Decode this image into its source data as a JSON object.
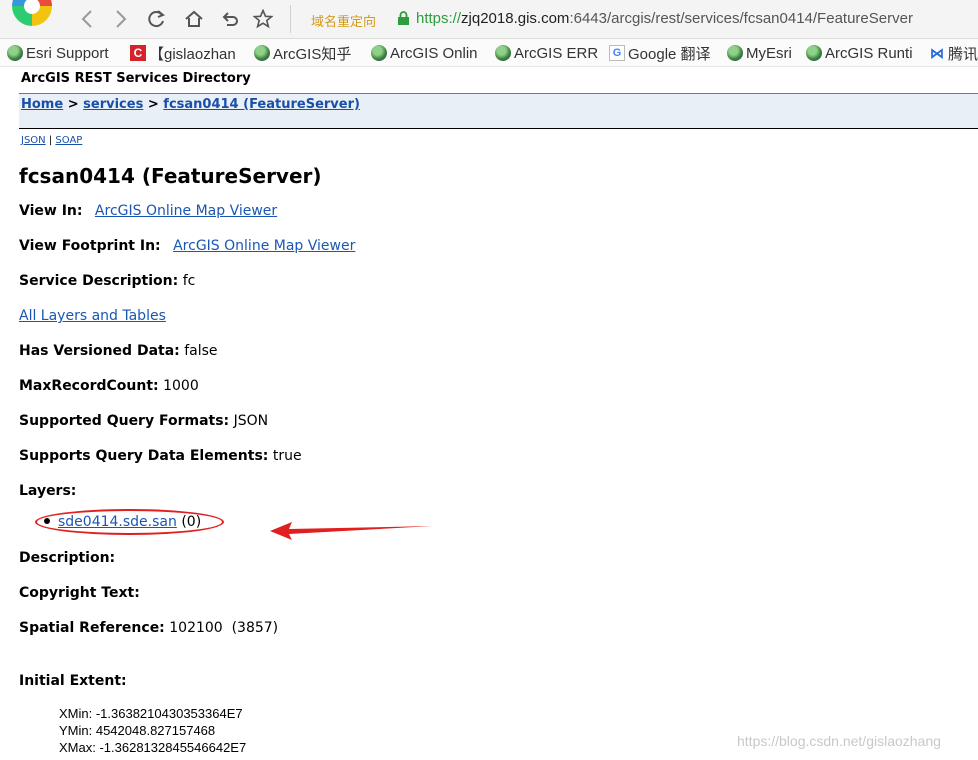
{
  "browser": {
    "redirect_label": "域名重定向",
    "url_scheme": "https://",
    "url_host": "zjq2018.gis.com",
    "url_path": ":6443/arcgis/rest/services/fcsan0414/FeatureServer",
    "bookmarks": [
      {
        "label": "Esri Support",
        "icon": "globe-icon"
      },
      {
        "label": "【gislaozhan",
        "icon": "csdn-icon"
      },
      {
        "label": "ArcGIS知乎",
        "icon": "globe-icon"
      },
      {
        "label": "ArcGIS Onlin",
        "icon": "globe-icon"
      },
      {
        "label": "ArcGIS ERR",
        "icon": "globe-icon"
      },
      {
        "label": "Google 翻译",
        "icon": "google-translate-icon"
      },
      {
        "label": "MyEsri",
        "icon": "globe-icon"
      },
      {
        "label": "ArcGIS Runti",
        "icon": "globe-icon"
      },
      {
        "label": "腾讯",
        "icon": "tencent-icon"
      }
    ]
  },
  "page": {
    "directory_title": "ArcGIS REST Services Directory",
    "breadcrumb": {
      "home": "Home",
      "sep": ">",
      "services": "services",
      "current": "fcsan0414 (FeatureServer)"
    },
    "formats": {
      "json": "JSON",
      "sep": "|",
      "soap": "SOAP"
    },
    "heading": "fcsan0414 (FeatureServer)",
    "view_in": {
      "label": "View In:",
      "link": "ArcGIS Online Map Viewer"
    },
    "view_footprint": {
      "label": "View Footprint In:",
      "link": "ArcGIS Online Map Viewer"
    },
    "service_description": {
      "label": "Service Description:",
      "value": "fc"
    },
    "all_layers_link": "All Layers and Tables",
    "has_versioned": {
      "label": "Has Versioned Data:",
      "value": "false"
    },
    "max_record": {
      "label": "MaxRecordCount:",
      "value": "1000"
    },
    "query_formats": {
      "label": "Supported Query Formats:",
      "value": "JSON"
    },
    "query_elements": {
      "label": "Supports Query Data Elements:",
      "value": "true"
    },
    "layers": {
      "label": "Layers:",
      "items": [
        {
          "name": "sde0414.sde.san",
          "id": "(0)"
        }
      ]
    },
    "description": {
      "label": "Description:"
    },
    "copyright": {
      "label": "Copyright Text:"
    },
    "spatial_ref": {
      "label": "Spatial Reference:",
      "value": "102100  (3857)"
    },
    "initial_extent": {
      "label": "Initial Extent:",
      "xmin": "XMin: -1.3638210430353364E7",
      "ymin": "YMin: 4542048.827157468",
      "xmax": "XMax: -1.3628132845546642E7"
    },
    "watermark": "https://blog.csdn.net/gislaozhang"
  },
  "colors": {
    "link": "#1a57b3",
    "annotation": "#e02020",
    "crumb_bg": "#e8eff7"
  }
}
